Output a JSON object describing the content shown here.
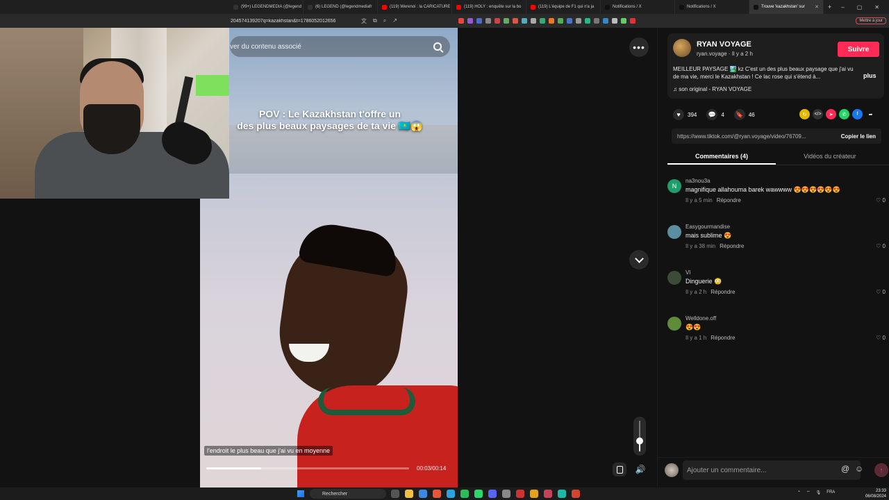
{
  "browser": {
    "tabs": [
      {
        "label": "(99+) LEGENDMEDIA (@legend",
        "color": "#333333",
        "active": false
      },
      {
        "label": "(6) LEGEND (@legendmediafr",
        "color": "#333333",
        "active": false
      },
      {
        "label": "(119) Werenoi : la CARICATURE",
        "color": "#ff0000",
        "active": false
      },
      {
        "label": "(119) HOLY : enquête sur la bo",
        "color": "#ff0000",
        "active": false
      },
      {
        "label": "(119) L'équipe de F1 qui n'a ja",
        "color": "#ff0000",
        "active": false
      },
      {
        "label": "Notifications / X",
        "color": "#111111",
        "active": false
      },
      {
        "label": "Notifications / X",
        "color": "#111111",
        "active": false
      },
      {
        "label": "Trouve 'kazakhstan' sur",
        "color": "#111111",
        "active": true
      }
    ],
    "url": "204574139207q=kazakhstan&t=1786052012656",
    "restart_label": "Mettre à jour"
  },
  "video": {
    "search_placeholder": "ver du contenu associé",
    "caption_line1": "POV : Le Kazakhstan t'offre un",
    "caption_line2": "des plus beaux paysages de ta vie 🇰🇿😱",
    "subtitle": "l'endroit le plus beau que j'ai vu en moyenne",
    "time": "00:03/00:14",
    "progress": 0.27,
    "volume": 0.35
  },
  "author": {
    "name": "RYAN VOYAGE",
    "sub": "ryan.voyage · Il y a 2 h",
    "follow_label": "Suivre",
    "description": "MEILLEUR PAYSAGE 🏞️ kz C'est un des plus beaux paysage que j'ai vu de ma vie, merci le Kazakhstan ! Ce lac rose qui s'étend à...",
    "more_label": "plus",
    "sound": "♫  son original - RYAN VOYAGE"
  },
  "stats": {
    "likes": "394",
    "comments": "4",
    "saves": "46"
  },
  "share": {
    "link": "https://www.tiktok.com/@ryan.voyage/video/76709...",
    "copy_label": "Copier le lien"
  },
  "panel_tabs": {
    "comments": "Commentaires (4)",
    "creator": "Vidéos du créateur"
  },
  "comments": [
    {
      "user": "na3nou3a",
      "text": "magnifique allahouma barek wawwww 😍😍😍😍😍😍",
      "time": "Il y a 5 min",
      "reply": "Répondre",
      "likes": "0",
      "avatar_color": "#1f9d6b",
      "avatar_letter": "N"
    },
    {
      "user": "Easygourmandise",
      "text": "mais sublime 😍",
      "time": "Il y a 38 min",
      "reply": "Répondre",
      "likes": "0",
      "avatar_color": "#5a8fa0",
      "avatar_letter": ""
    },
    {
      "user": "Vl",
      "text": "Dinguerie 😳",
      "time": "Il y a 2 h",
      "reply": "Répondre",
      "likes": "0",
      "avatar_color": "#3d4a3a",
      "avatar_letter": ""
    },
    {
      "user": "Welldone.off",
      "text": "😍😍",
      "time": "Il y a 1 h",
      "reply": "Répondre",
      "likes": "0",
      "avatar_color": "#5e8c3b",
      "avatar_letter": ""
    }
  ],
  "comment_input": {
    "placeholder": "Ajouter un commentaire..."
  },
  "taskbar": {
    "search_label": "Rechercher",
    "lang": "FRA",
    "time": "23:33",
    "date": "06/08/2024"
  }
}
